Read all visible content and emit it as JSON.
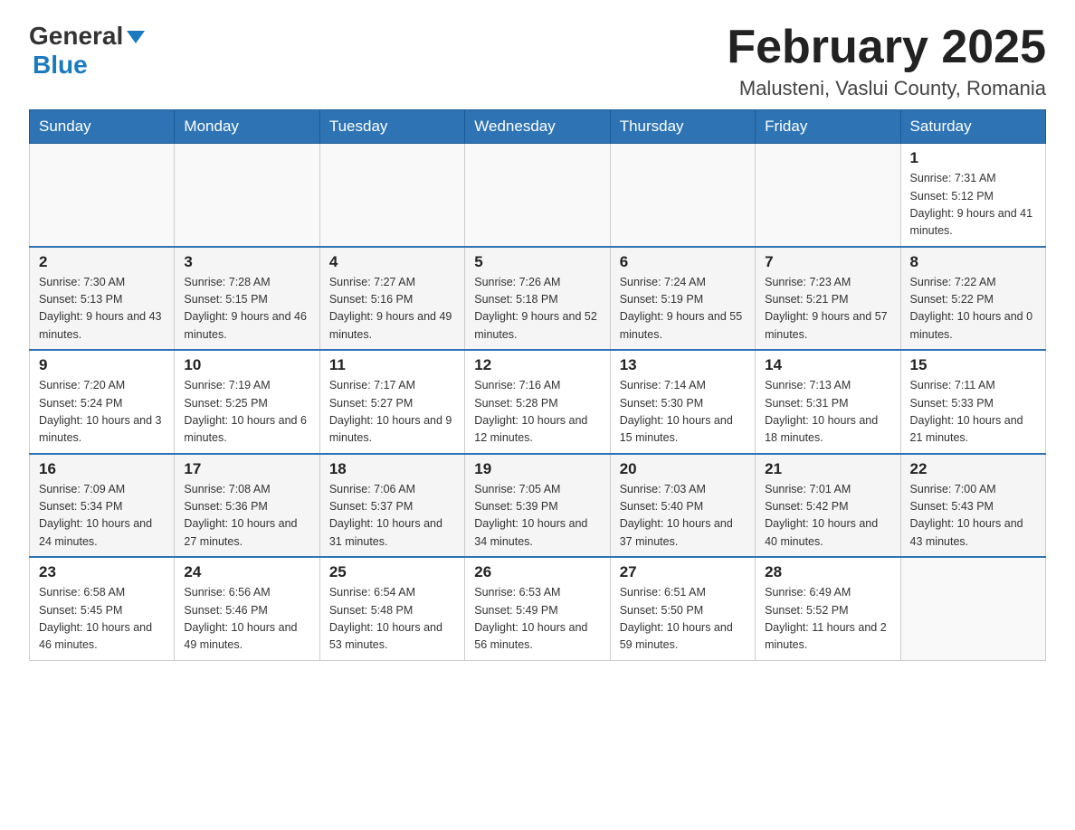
{
  "header": {
    "logo_general": "General",
    "logo_blue": "Blue",
    "title": "February 2025",
    "subtitle": "Malusteni, Vaslui County, Romania"
  },
  "days_of_week": [
    "Sunday",
    "Monday",
    "Tuesday",
    "Wednesday",
    "Thursday",
    "Friday",
    "Saturday"
  ],
  "weeks": [
    [
      {
        "day": "",
        "info": ""
      },
      {
        "day": "",
        "info": ""
      },
      {
        "day": "",
        "info": ""
      },
      {
        "day": "",
        "info": ""
      },
      {
        "day": "",
        "info": ""
      },
      {
        "day": "",
        "info": ""
      },
      {
        "day": "1",
        "info": "Sunrise: 7:31 AM\nSunset: 5:12 PM\nDaylight: 9 hours and 41 minutes."
      }
    ],
    [
      {
        "day": "2",
        "info": "Sunrise: 7:30 AM\nSunset: 5:13 PM\nDaylight: 9 hours and 43 minutes."
      },
      {
        "day": "3",
        "info": "Sunrise: 7:28 AM\nSunset: 5:15 PM\nDaylight: 9 hours and 46 minutes."
      },
      {
        "day": "4",
        "info": "Sunrise: 7:27 AM\nSunset: 5:16 PM\nDaylight: 9 hours and 49 minutes."
      },
      {
        "day": "5",
        "info": "Sunrise: 7:26 AM\nSunset: 5:18 PM\nDaylight: 9 hours and 52 minutes."
      },
      {
        "day": "6",
        "info": "Sunrise: 7:24 AM\nSunset: 5:19 PM\nDaylight: 9 hours and 55 minutes."
      },
      {
        "day": "7",
        "info": "Sunrise: 7:23 AM\nSunset: 5:21 PM\nDaylight: 9 hours and 57 minutes."
      },
      {
        "day": "8",
        "info": "Sunrise: 7:22 AM\nSunset: 5:22 PM\nDaylight: 10 hours and 0 minutes."
      }
    ],
    [
      {
        "day": "9",
        "info": "Sunrise: 7:20 AM\nSunset: 5:24 PM\nDaylight: 10 hours and 3 minutes."
      },
      {
        "day": "10",
        "info": "Sunrise: 7:19 AM\nSunset: 5:25 PM\nDaylight: 10 hours and 6 minutes."
      },
      {
        "day": "11",
        "info": "Sunrise: 7:17 AM\nSunset: 5:27 PM\nDaylight: 10 hours and 9 minutes."
      },
      {
        "day": "12",
        "info": "Sunrise: 7:16 AM\nSunset: 5:28 PM\nDaylight: 10 hours and 12 minutes."
      },
      {
        "day": "13",
        "info": "Sunrise: 7:14 AM\nSunset: 5:30 PM\nDaylight: 10 hours and 15 minutes."
      },
      {
        "day": "14",
        "info": "Sunrise: 7:13 AM\nSunset: 5:31 PM\nDaylight: 10 hours and 18 minutes."
      },
      {
        "day": "15",
        "info": "Sunrise: 7:11 AM\nSunset: 5:33 PM\nDaylight: 10 hours and 21 minutes."
      }
    ],
    [
      {
        "day": "16",
        "info": "Sunrise: 7:09 AM\nSunset: 5:34 PM\nDaylight: 10 hours and 24 minutes."
      },
      {
        "day": "17",
        "info": "Sunrise: 7:08 AM\nSunset: 5:36 PM\nDaylight: 10 hours and 27 minutes."
      },
      {
        "day": "18",
        "info": "Sunrise: 7:06 AM\nSunset: 5:37 PM\nDaylight: 10 hours and 31 minutes."
      },
      {
        "day": "19",
        "info": "Sunrise: 7:05 AM\nSunset: 5:39 PM\nDaylight: 10 hours and 34 minutes."
      },
      {
        "day": "20",
        "info": "Sunrise: 7:03 AM\nSunset: 5:40 PM\nDaylight: 10 hours and 37 minutes."
      },
      {
        "day": "21",
        "info": "Sunrise: 7:01 AM\nSunset: 5:42 PM\nDaylight: 10 hours and 40 minutes."
      },
      {
        "day": "22",
        "info": "Sunrise: 7:00 AM\nSunset: 5:43 PM\nDaylight: 10 hours and 43 minutes."
      }
    ],
    [
      {
        "day": "23",
        "info": "Sunrise: 6:58 AM\nSunset: 5:45 PM\nDaylight: 10 hours and 46 minutes."
      },
      {
        "day": "24",
        "info": "Sunrise: 6:56 AM\nSunset: 5:46 PM\nDaylight: 10 hours and 49 minutes."
      },
      {
        "day": "25",
        "info": "Sunrise: 6:54 AM\nSunset: 5:48 PM\nDaylight: 10 hours and 53 minutes."
      },
      {
        "day": "26",
        "info": "Sunrise: 6:53 AM\nSunset: 5:49 PM\nDaylight: 10 hours and 56 minutes."
      },
      {
        "day": "27",
        "info": "Sunrise: 6:51 AM\nSunset: 5:50 PM\nDaylight: 10 hours and 59 minutes."
      },
      {
        "day": "28",
        "info": "Sunrise: 6:49 AM\nSunset: 5:52 PM\nDaylight: 11 hours and 2 minutes."
      },
      {
        "day": "",
        "info": ""
      }
    ]
  ]
}
